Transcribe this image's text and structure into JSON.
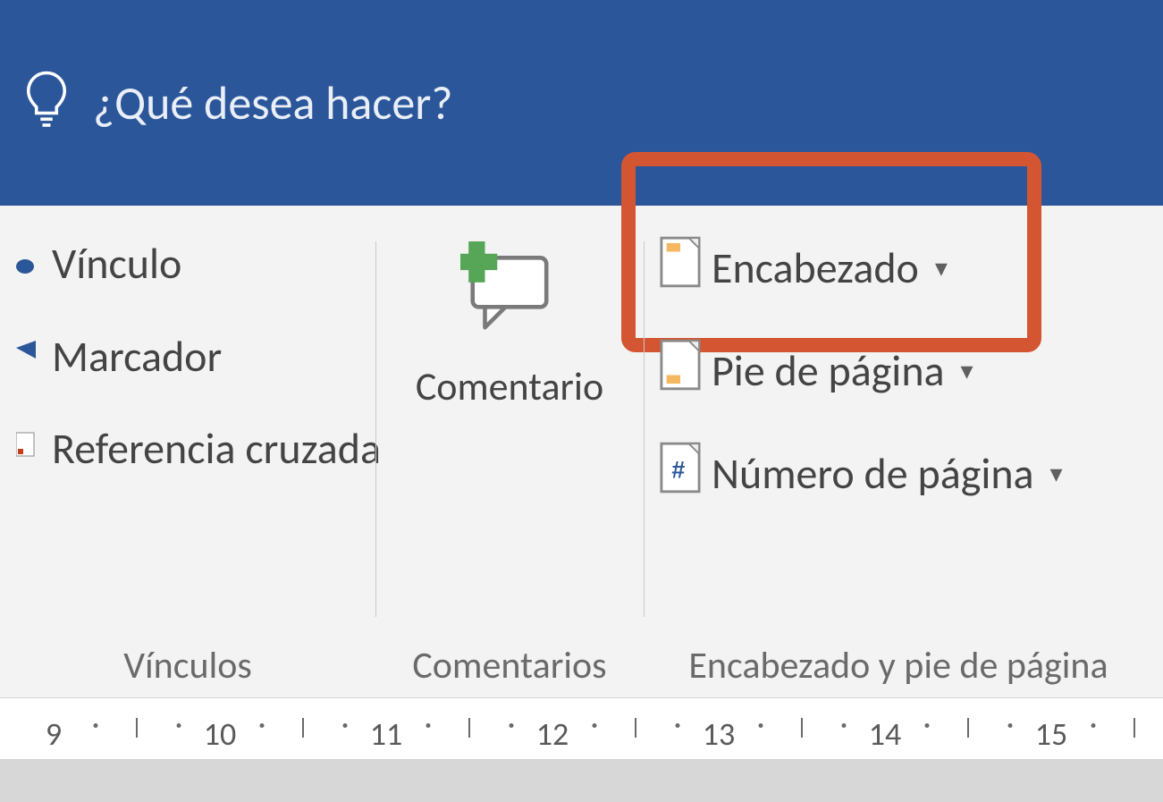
{
  "tellme_placeholder": "¿Qué desea hacer?",
  "groups": {
    "links": {
      "items": {
        "link": "Vínculo",
        "bookmark": "Marcador",
        "crossref": "Referencia cruzada"
      },
      "label": "Vínculos"
    },
    "comments": {
      "button": "Comentario",
      "label": "Comentarios"
    },
    "headerfooter": {
      "items": {
        "header": "Encabezado",
        "footer": "Pie de página",
        "pagenum": "Número de página"
      },
      "label": "Encabezado y pie de página"
    }
  },
  "ruler": {
    "marks": [
      "9",
      "10",
      "11",
      "12",
      "13",
      "14",
      "15"
    ]
  }
}
